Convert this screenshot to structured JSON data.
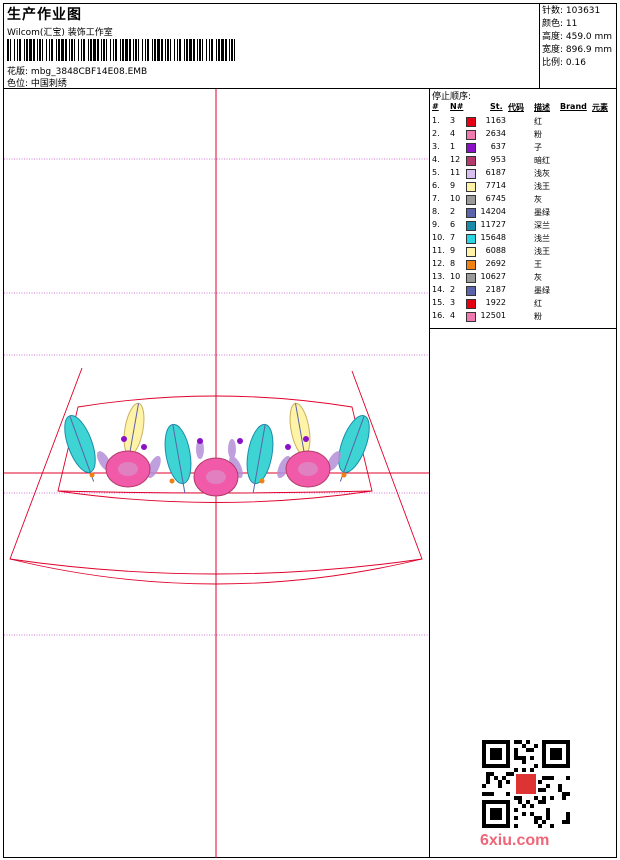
{
  "header": {
    "title": "生产作业图",
    "company": "Wilcom(汇宝) 装饰工作室",
    "design_label": "花版:",
    "design_file": "mbg_3848CBF14E08.EMB",
    "colorway_label": "色位:",
    "colorway": "中国刺绣"
  },
  "stats": {
    "stitches": "针数: 103631",
    "colors": "颜色: 11",
    "height": "高度: 459.0 mm",
    "width": "宽度: 896.9 mm",
    "scale": "比例: 0.16"
  },
  "stop_sequence": {
    "title": "停止顺序:",
    "columns": [
      "#",
      "N#",
      "St.",
      "代码",
      "描述",
      "Brand",
      "元素"
    ],
    "rows": [
      {
        "idx": "1.",
        "n": "3",
        "st": "1163",
        "desc": "红",
        "color": "#e60012"
      },
      {
        "idx": "2.",
        "n": "4",
        "st": "2634",
        "desc": "粉",
        "color": "#f07ab0"
      },
      {
        "idx": "3.",
        "n": "1",
        "st": "637",
        "desc": "子",
        "color": "#8b10c8"
      },
      {
        "idx": "4.",
        "n": "12",
        "st": "953",
        "desc": "暗红",
        "color": "#b33a6a"
      },
      {
        "idx": "5.",
        "n": "11",
        "st": "6187",
        "desc": "浅灰",
        "color": "#d8c0f0"
      },
      {
        "idx": "6.",
        "n": "9",
        "st": "7714",
        "desc": "浅王",
        "color": "#fff3a8"
      },
      {
        "idx": "7.",
        "n": "10",
        "st": "6745",
        "desc": "灰",
        "color": "#9a9a9a"
      },
      {
        "idx": "8.",
        "n": "2",
        "st": "14204",
        "desc": "墨绿",
        "color": "#5a64a8"
      },
      {
        "idx": "9.",
        "n": "6",
        "st": "11727",
        "desc": "深兰",
        "color": "#1a8caa"
      },
      {
        "idx": "10.",
        "n": "7",
        "st": "15648",
        "desc": "浅兰",
        "color": "#2ad4e0"
      },
      {
        "idx": "11.",
        "n": "9",
        "st": "6088",
        "desc": "浅王",
        "color": "#fff3a8"
      },
      {
        "idx": "12.",
        "n": "8",
        "st": "2692",
        "desc": "王",
        "color": "#f08010"
      },
      {
        "idx": "13.",
        "n": "10",
        "st": "10627",
        "desc": "灰",
        "color": "#9a9a9a"
      },
      {
        "idx": "14.",
        "n": "2",
        "st": "2187",
        "desc": "墨绿",
        "color": "#5a64a8"
      },
      {
        "idx": "15.",
        "n": "3",
        "st": "1922",
        "desc": "红",
        "color": "#e60012"
      },
      {
        "idx": "16.",
        "n": "4",
        "st": "12501",
        "desc": "粉",
        "color": "#f07ab0"
      }
    ]
  },
  "watermark": "6xiu.com"
}
